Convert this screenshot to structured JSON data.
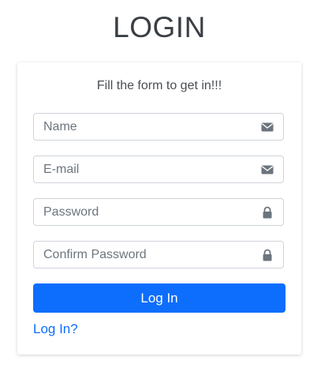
{
  "page": {
    "title": "LOGIN"
  },
  "form": {
    "subtitle": "Fill the form to get in!!!",
    "fields": [
      {
        "placeholder": "Name",
        "value": "",
        "icon": "envelope-icon"
      },
      {
        "placeholder": "E-mail",
        "value": "",
        "icon": "envelope-icon"
      },
      {
        "placeholder": "Password",
        "value": "",
        "icon": "lock-icon"
      },
      {
        "placeholder": "Confirm Password",
        "value": "",
        "icon": "lock-icon"
      }
    ],
    "submit_label": "Log In",
    "link_label": "Log In?"
  },
  "colors": {
    "primary": "#0d6efd",
    "title_text": "#3a3f45",
    "icon": "#6c757d",
    "border": "#ced4da"
  }
}
